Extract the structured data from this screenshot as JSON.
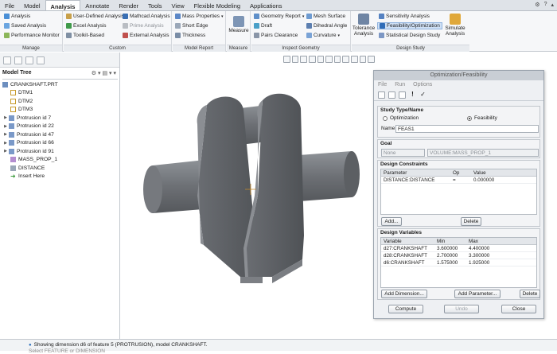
{
  "menubar": {
    "items": [
      "File",
      "Model",
      "Analysis",
      "Annotate",
      "Render",
      "Tools",
      "View",
      "Flexible Modeling",
      "Applications"
    ],
    "active_index": 2
  },
  "ribbon": {
    "manage": {
      "items": [
        "Analysis",
        "Saved Analysis",
        "Performance Monitor"
      ],
      "label": "Manage"
    },
    "custom": {
      "items": [
        "User-Defined Analysis",
        "Excel Analysis",
        "Toolkit-Based",
        "Mathcad Analysis",
        "Prime Analysis",
        "External Analysis"
      ],
      "label": "Custom"
    },
    "model_report": {
      "items": [
        "Mass Properties",
        "Short Edge",
        "Thickness"
      ],
      "label": "Model Report"
    },
    "measure": {
      "button": "Measure",
      "label": "Measure"
    },
    "inspect": {
      "items": [
        "Geometry Report",
        "Draft",
        "Pairs Clearance",
        "Mesh Surface",
        "Dihedral Angle",
        "Curvature"
      ],
      "label": "Inspect Geometry"
    },
    "design_study": {
      "tolerance": "Tolerance Analysis",
      "items": [
        "Sensitivity Analysis",
        "Feasibility/Optimization",
        "Statistical Design Study"
      ],
      "simulate": "Simulate Analysis",
      "label": "Design Study"
    }
  },
  "model_tree": {
    "header": "Model Tree",
    "items": [
      {
        "label": "CRANKSHAFT.PRT",
        "expandable": false
      },
      {
        "label": "DTM1",
        "expandable": false
      },
      {
        "label": "DTM2",
        "expandable": false
      },
      {
        "label": "DTM3",
        "expandable": false
      },
      {
        "label": "Protrusion id 7",
        "expandable": true
      },
      {
        "label": "Protrusion id 22",
        "expandable": true
      },
      {
        "label": "Protrusion id 47",
        "expandable": true
      },
      {
        "label": "Protrusion id 66",
        "expandable": true
      },
      {
        "label": "Protrusion id 91",
        "expandable": true
      },
      {
        "label": "MASS_PROP_1",
        "expandable": false
      },
      {
        "label": "DISTANCE",
        "expandable": false
      },
      {
        "label": "Insert Here",
        "expandable": false
      }
    ]
  },
  "dialog": {
    "title": "Optimization/Feasibility",
    "menu": [
      "File",
      "Run",
      "Options"
    ],
    "study": {
      "header": "Study Type/Name",
      "option1": "Optimization",
      "option2": "Feasibility",
      "selected": "Feasibility",
      "name_label": "Name",
      "name_value": "FEAS1"
    },
    "goal": {
      "header": "Goal",
      "type_value": "None",
      "target_value": "VOLUME:MASS_PROP_1"
    },
    "constraints": {
      "header": "Design Constraints",
      "columns": [
        "Parameter",
        "Op",
        "Value"
      ],
      "rows": [
        [
          "DISTANCE:DISTANCE",
          "=",
          "0.000000"
        ]
      ],
      "add_label": "Add...",
      "delete_label": "Delete"
    },
    "variables": {
      "header": "Design Variables",
      "columns": [
        "Variable",
        "Min",
        "Max"
      ],
      "rows": [
        [
          "d27:CRANKSHAFT",
          "3.600000",
          "4.400000"
        ],
        [
          "d28:CRANKSHAFT",
          "2.700000",
          "3.300000"
        ],
        [
          "d6:CRANKSHAFT",
          "1.575000",
          "1.925000"
        ]
      ],
      "add_dimension_label": "Add Dimension...",
      "add_parameter_label": "Add Parameter...",
      "delete_label": "Delete"
    },
    "footer": {
      "compute": "Compute",
      "undo": "Undo",
      "close": "Close"
    }
  },
  "status": {
    "message": "Showing dimension d6 of feature 5 (PROTRUSION), model CRANKSHAFT.",
    "message2": "Select FEATURE or DIMENSION"
  },
  "colors": {
    "part_dark": "#5f6266",
    "part_mid": "#7c8085",
    "part_light": "#9a9ea3",
    "accent": "#2a6ebd"
  }
}
